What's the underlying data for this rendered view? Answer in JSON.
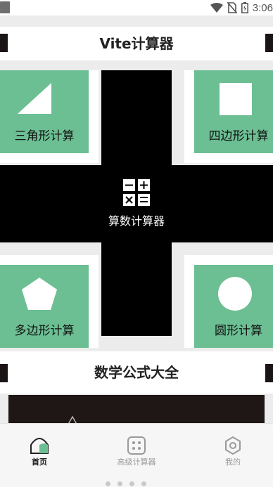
{
  "status_bar": {
    "time": "3:06"
  },
  "header": {
    "title": "Vite计算器"
  },
  "tiles": {
    "triangle": {
      "label": "三角形计算",
      "icon": "triangle-icon"
    },
    "square": {
      "label": "四边形计算",
      "icon": "square-icon"
    },
    "calculator": {
      "label": "算数计算器",
      "icon": "calculator-icon"
    },
    "polygon": {
      "label": "多边形计算",
      "icon": "pentagon-icon"
    },
    "circle": {
      "label": "圆形计算",
      "icon": "circle-icon"
    }
  },
  "section": {
    "title": "数学公式大全"
  },
  "tab_bar": {
    "tabs": [
      {
        "label": "首页",
        "icon": "home-icon",
        "active": true
      },
      {
        "label": "高级计算器",
        "icon": "calculator-grid-icon",
        "active": false
      },
      {
        "label": "我的",
        "icon": "gear-icon",
        "active": false
      }
    ]
  },
  "colors": {
    "tile_green": "#6cbf93",
    "cross_black": "#000000",
    "accent_active": "#222222",
    "inactive": "#9a9a9a"
  }
}
